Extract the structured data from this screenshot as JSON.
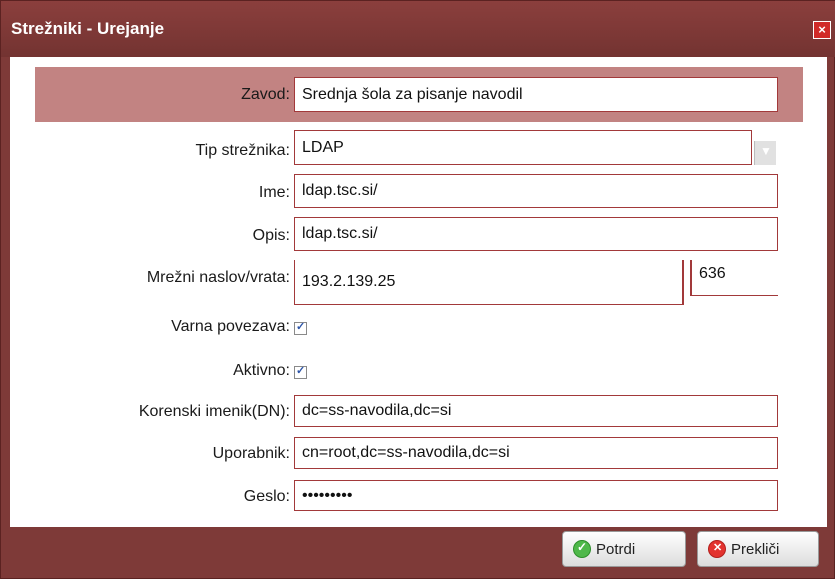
{
  "window": {
    "title": "Strežniki - Urejanje",
    "close_icon": "×"
  },
  "form": {
    "zavod": {
      "label": "Zavod:",
      "value": "Srednja šola za pisanje navodil"
    },
    "tip": {
      "label": "Tip strežnika:",
      "value": "LDAP"
    },
    "ime": {
      "label": "Ime:",
      "value": "ldap.tsc.si/"
    },
    "opis": {
      "label": "Opis:",
      "value": "ldap.tsc.si/"
    },
    "naslov": {
      "label": "Mrežni naslov/vrata:",
      "address": "193.2.139.25",
      "port": "636"
    },
    "varna": {
      "label": "Varna povezava:",
      "checked": true
    },
    "aktivno": {
      "label": "Aktivno:",
      "checked": true
    },
    "korenski": {
      "label": "Korenski imenik(DN):",
      "value": "dc=ss-navodila,dc=si"
    },
    "uporabnik": {
      "label": "Uporabnik:",
      "value": "cn=root,dc=ss-navodila,dc=si"
    },
    "geslo": {
      "label": "Geslo:",
      "value": "•••••••••"
    }
  },
  "buttons": {
    "confirm": "Potrdi",
    "cancel": "Prekliči"
  },
  "icons": {
    "confirm": "check-circle-icon",
    "cancel": "x-circle-icon",
    "dropdown": "chevron-down-icon"
  },
  "colors": {
    "frame": "#7e3a38",
    "band": "#c28382",
    "field_border": "#a2393a"
  }
}
